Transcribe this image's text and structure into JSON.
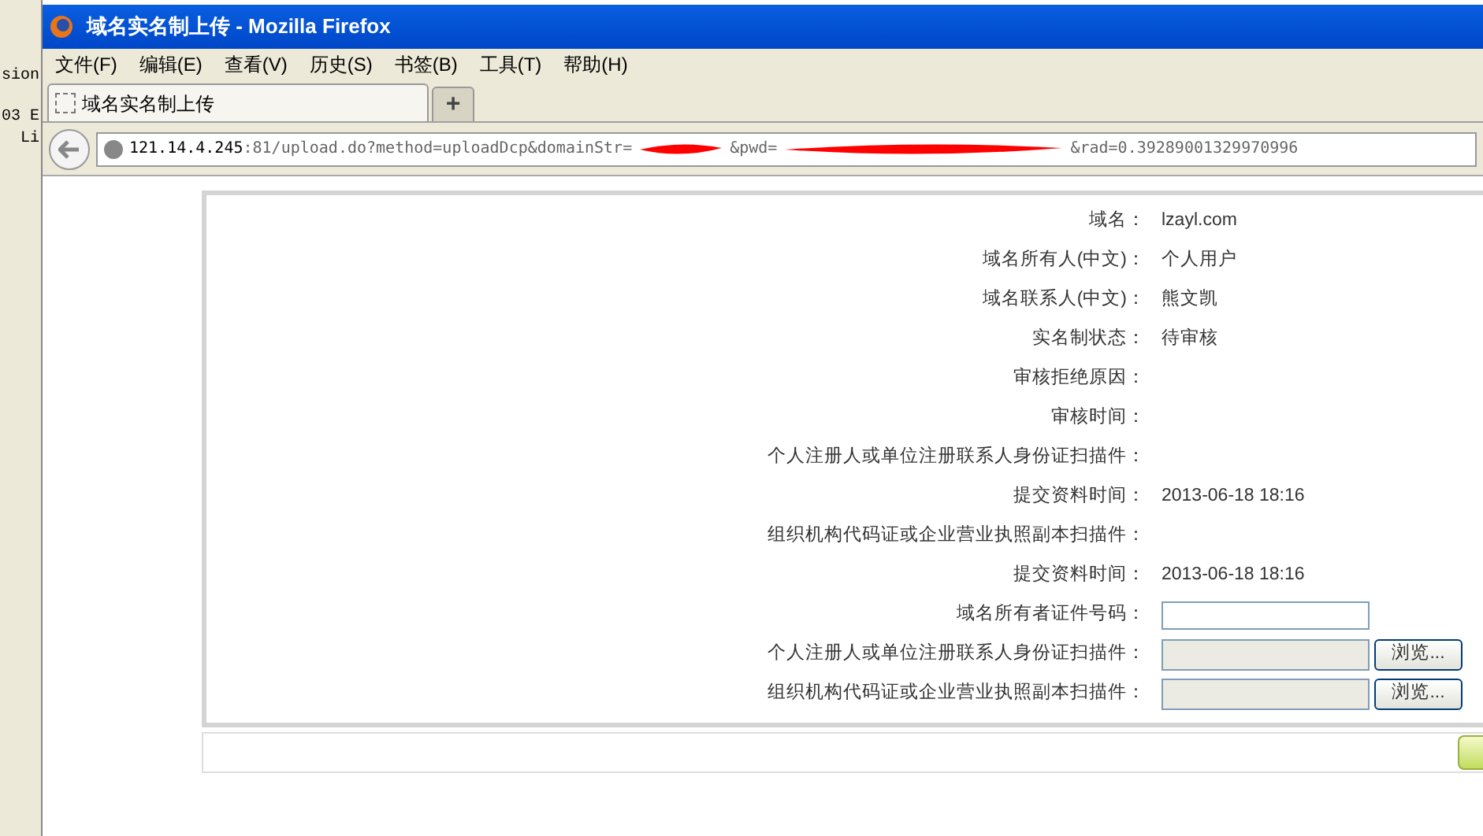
{
  "left_strip": {
    "lines": [
      "sion",
      "03 E",
      "Li"
    ]
  },
  "window": {
    "title": "域名实名制上传 - Mozilla Firefox"
  },
  "menu": [
    "文件(F)",
    "编辑(E)",
    "查看(V)",
    "历史(S)",
    "书签(B)",
    "工具(T)",
    "帮助(H)"
  ],
  "tabs": [
    {
      "label": "域名实名制上传",
      "selected": true
    }
  ],
  "new_tab": "+",
  "address": {
    "host": "121.14.4.245",
    "parts": [
      ":81/upload.do?method=uploadDcp&domainStr=",
      "&pwd=",
      "&rad=0.39289001329970996"
    ]
  },
  "form": {
    "rows": [
      {
        "kind": "text",
        "label": "域名：",
        "value": "lzayl.com"
      },
      {
        "kind": "text",
        "label": "域名所有人(中文)：",
        "value": "个人用户"
      },
      {
        "kind": "text",
        "label": "域名联系人(中文)：",
        "value": "熊文凯"
      },
      {
        "kind": "text",
        "label": "实名制状态：",
        "value": "待审核"
      },
      {
        "kind": "text",
        "label": "审核拒绝原因："
      },
      {
        "kind": "text",
        "label": "审核时间："
      },
      {
        "kind": "text",
        "label": "个人注册人或单位注册联系人身份证扫描件："
      },
      {
        "kind": "text",
        "label": "提交资料时间：",
        "value": "2013-06-18 18:16"
      },
      {
        "kind": "text",
        "label": "组织机构代码证或企业营业执照副本扫描件："
      },
      {
        "kind": "text",
        "label": "提交资料时间：",
        "value": "2013-06-18 18:16"
      },
      {
        "kind": "input",
        "label": "域名所有者证件号码："
      },
      {
        "kind": "file",
        "label": "个人注册人或单位注册联系人身份证扫描件：",
        "button": "浏览..."
      },
      {
        "kind": "file",
        "label": "组织机构代码证或企业营业执照副本扫描件：",
        "button": "浏览..."
      }
    ]
  }
}
